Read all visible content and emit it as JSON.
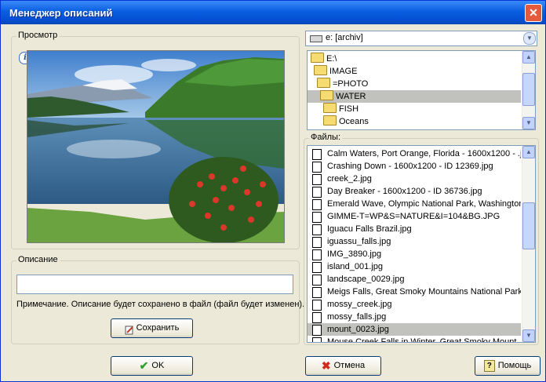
{
  "window": {
    "title": "Менеджер описаний"
  },
  "preview_group": {
    "label": "Просмотр"
  },
  "description_group": {
    "label": "Описание",
    "value": "",
    "note": "Примечание. Описание будет сохранено в файл (файл будет изменен).",
    "save_label": "Сохранить"
  },
  "drive": {
    "selected": "e: [archiv]"
  },
  "tree": {
    "items": [
      {
        "label": "E:\\",
        "level": 0
      },
      {
        "label": "IMAGE",
        "level": 1
      },
      {
        "label": "=PHOTO",
        "level": 2
      },
      {
        "label": "WATER",
        "level": 3,
        "selected": true
      },
      {
        "label": "FISH",
        "level": 4
      },
      {
        "label": "Oceans",
        "level": 4
      }
    ]
  },
  "files": {
    "label": "Файлы:",
    "items": [
      "Calm Waters, Port Orange, Florida - 1600x1200 - .jpg",
      "Crashing Down - 1600x1200 - ID 12369.jpg",
      "creek_2.jpg",
      "Day Breaker - 1600x1200 - ID 36736.jpg",
      "Emerald Wave, Olympic National Park, Washington",
      "GIMME-T=WP&S=NATURE&I=104&BG.JPG",
      "Iguacu Falls Brazil.jpg",
      "iguassu_falls.jpg",
      "IMG_3890.jpg",
      "island_001.jpg",
      "landscape_0029.jpg",
      "Meigs Falls, Great Smoky Mountains National Park.jp",
      "mossy_creek.jpg",
      "mossy_falls.jpg",
      "mount_0023.jpg",
      "Mouse Creek Falls in Winter, Great Smoky Mount"
    ],
    "selected_index": 14
  },
  "buttons": {
    "ok": "OK",
    "cancel": "Отмена",
    "help": "Помощь"
  },
  "icons": {
    "info": "info-icon",
    "drive": "drive-icon",
    "folder": "folder-icon",
    "file": "file-icon"
  }
}
